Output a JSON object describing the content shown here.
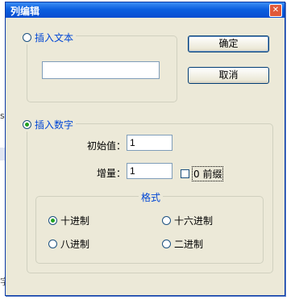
{
  "background": {
    "side_text": "a",
    "bottom_glyph": "字"
  },
  "dialog": {
    "title": "列编辑",
    "close_glyph": "✕",
    "insert_text": {
      "label": "插入文本",
      "value": ""
    },
    "insert_number": {
      "label": "插入数字",
      "initial_label": "初始值：",
      "initial_value": "1",
      "increment_label": "增量：",
      "increment_value": "1",
      "prefix_zero_label": "0 前缀",
      "format": {
        "title": "格式",
        "options": [
          "十进制",
          "十六进制",
          "八进制",
          "二进制"
        ]
      }
    },
    "buttons": {
      "ok": "确定",
      "cancel": "取消"
    }
  }
}
